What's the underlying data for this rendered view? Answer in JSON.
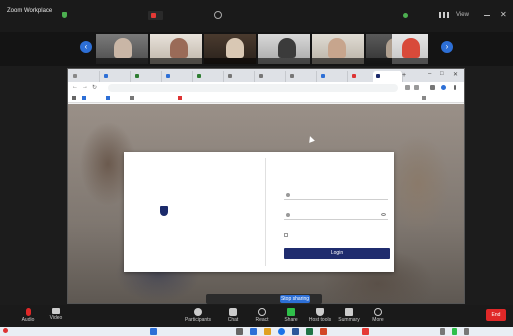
{
  "meeting": {
    "app_title": "Zoom Workplace",
    "shield_label": "",
    "recording_label": "",
    "speaker_label": "",
    "connection_label": "",
    "view_label": "View"
  },
  "participants": [
    {
      "name": ""
    },
    {
      "name": ""
    },
    {
      "name": ""
    },
    {
      "name": ""
    },
    {
      "name": ""
    },
    {
      "name": ""
    },
    {
      "name": ""
    }
  ],
  "browser": {
    "tabs": [
      {
        "label": ""
      },
      {
        "label": ""
      },
      {
        "label": ""
      },
      {
        "label": ""
      },
      {
        "label": ""
      },
      {
        "label": ""
      },
      {
        "label": ""
      },
      {
        "label": ""
      },
      {
        "label": ""
      },
      {
        "label": ""
      },
      {
        "label": ""
      }
    ],
    "url": "",
    "bookmarks": [
      {
        "label": ""
      },
      {
        "label": ""
      },
      {
        "label": ""
      },
      {
        "label": ""
      }
    ],
    "bookmarks_right": ""
  },
  "login": {
    "brand": "",
    "title": "",
    "username_placeholder": "",
    "password_placeholder": "",
    "remember_label": "",
    "forgot_label": "",
    "button_label": "Login"
  },
  "share_banner": {
    "text": "",
    "stop_label": "Stop sharing",
    "hide_label": ""
  },
  "controls": [
    {
      "label": "Audio",
      "icon": "microphone-icon"
    },
    {
      "label": "Video",
      "icon": "camera-icon"
    },
    {
      "label": "Participants",
      "icon": "participants-icon"
    },
    {
      "label": "Chat",
      "icon": "chat-icon"
    },
    {
      "label": "React",
      "icon": "react-icon"
    },
    {
      "label": "Share",
      "icon": "share-icon"
    },
    {
      "label": "Host tools",
      "icon": "host-tools-icon"
    },
    {
      "label": "Summary",
      "icon": "summary-icon"
    },
    {
      "label": "More",
      "icon": "more-icon"
    }
  ],
  "end_label": "End",
  "taskbar": {
    "left_label": "",
    "clock": ""
  },
  "colors": {
    "zoom_blue": "#2d6fd6",
    "recording_red": "#e53935",
    "login_navy": "#1f2c6e",
    "end_red": "#e02828"
  }
}
